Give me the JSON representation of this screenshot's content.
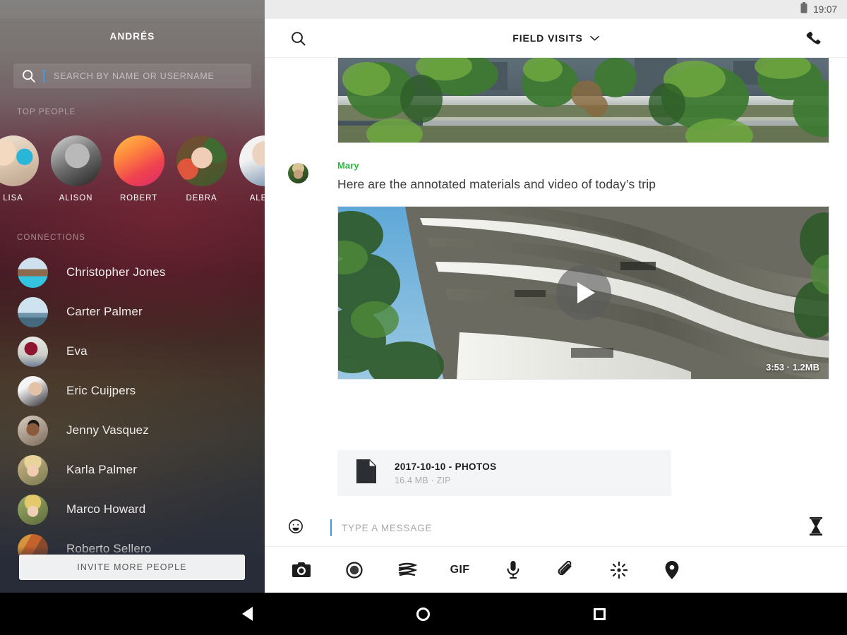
{
  "sidebar": {
    "title": "ANDRÉS",
    "search": {
      "placeholder": "SEARCH BY NAME OR USERNAME"
    },
    "section_top_people": "TOP PEOPLE",
    "section_connections": "CONNECTIONS",
    "top_people": [
      {
        "name": "LISA",
        "art": "ph-lisa"
      },
      {
        "name": "ALISON",
        "art": "ph-alison"
      },
      {
        "name": "ROBERT",
        "art": "ph-robert"
      },
      {
        "name": "DEBRA",
        "art": "ph-debra"
      },
      {
        "name": "ALEKS",
        "art": "ph-alek"
      }
    ],
    "connections": [
      {
        "name": "Christopher Jones",
        "art": "ph-chris"
      },
      {
        "name": "Carter Palmer",
        "art": "ph-carter"
      },
      {
        "name": "Eva",
        "art": "ph-eva"
      },
      {
        "name": "Eric Cuijpers",
        "art": "ph-eric"
      },
      {
        "name": "Jenny Vasquez",
        "art": "ph-jenny"
      },
      {
        "name": "Karla Palmer",
        "art": "ph-karla"
      },
      {
        "name": "Marco Howard",
        "art": "ph-marco"
      },
      {
        "name": "Roberto Sellero",
        "art": "ph-roberto"
      }
    ],
    "invite_label": "INVITE MORE PEOPLE"
  },
  "statusbar": {
    "time": "19:07",
    "battery_icon": "battery-icon"
  },
  "chat": {
    "title": "FIELD VISITS",
    "search_icon": "search-icon",
    "call_icon": "phone-icon",
    "dropdown_icon": "chevron-down-icon",
    "message": {
      "sender": "Mary",
      "sender_color": "#2fb842",
      "text": "Here are the annotated materials and video of today’s trip",
      "avatar_art": "ph-mary"
    },
    "video": {
      "duration": "3:53",
      "separator": "·",
      "size": "1.2MB",
      "meta": "3:53 · 1.2MB"
    },
    "file": {
      "name": "2017-10-10 - PHOTOS",
      "meta": "16.4 MB · ZIP"
    },
    "composer": {
      "placeholder": "TYPE A MESSAGE",
      "emoji_icon": "emoji-icon",
      "timer_icon": "hourglass-icon"
    },
    "toolbar": [
      {
        "icon": "camera-icon",
        "label": ""
      },
      {
        "icon": "record-icon",
        "label": ""
      },
      {
        "icon": "sticker-icon",
        "label": ""
      },
      {
        "icon": "gif-icon",
        "label": "GIF"
      },
      {
        "icon": "microphone-icon",
        "label": ""
      },
      {
        "icon": "attachment-icon",
        "label": ""
      },
      {
        "icon": "sparkle-icon",
        "label": ""
      },
      {
        "icon": "location-icon",
        "label": ""
      }
    ]
  },
  "navbar": {
    "back_icon": "back-triangle-icon",
    "home_icon": "home-circle-icon",
    "recents_icon": "recents-square-icon"
  }
}
